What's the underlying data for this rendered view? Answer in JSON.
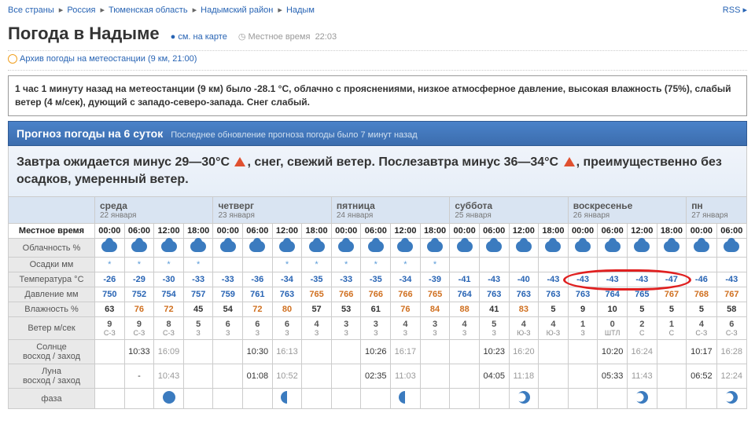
{
  "breadcrumb": [
    "Все страны",
    "Россия",
    "Тюменская область",
    "Надымский район",
    "Надым"
  ],
  "rss": "RSS",
  "title": "Погода в Надыме",
  "map_link": "см. на карте",
  "local_time_label": "Местное время",
  "local_time": "22:03",
  "archive": "Архив погоды на метеостанции (9 км, 21:00)",
  "now": "1 час 1 минуту назад на метеостанции (9 км) было -28.1 °C, облачно с прояснениями, низкое атмосферное давление, высокая влажность (75%), слабый ветер (4 м/сек), дующий с западо-северо-запада. Снег слабый.",
  "forecast_header": "Прогноз погоды на 6 суток",
  "forecast_upd": "Последнее обновление прогноза погоды было 7 минут назад",
  "summary": {
    "p1": "Завтра ожидается минус 29—30°C",
    "p2": ", снег, свежий ветер. Послезавтра минус 36—34°C",
    "p3": ", преимущественно без осадков, умеренный ветер."
  },
  "row_labels": {
    "time": "Местное время",
    "cloud": "Облачность %",
    "precip": "Осадки мм",
    "temp": "Температура °C",
    "press": "Давление мм",
    "hum": "Влажность %",
    "wind": "Ветер м/сек",
    "sun": "Солнце\nвосход / заход",
    "moon": "Луна\nвосход / заход",
    "phase": "фаза"
  },
  "days": [
    {
      "name": "среда",
      "date": "22 января",
      "hours": [
        "00:00",
        "06:00",
        "12:00",
        "18:00"
      ]
    },
    {
      "name": "четверг",
      "date": "23 января",
      "hours": [
        "00:00",
        "06:00",
        "12:00",
        "18:00"
      ]
    },
    {
      "name": "пятница",
      "date": "24 января",
      "hours": [
        "00:00",
        "06:00",
        "12:00",
        "18:00"
      ]
    },
    {
      "name": "суббота",
      "date": "25 января",
      "hours": [
        "00:00",
        "06:00",
        "12:00",
        "18:00"
      ]
    },
    {
      "name": "воскресенье",
      "date": "26 января",
      "hours": [
        "00:00",
        "06:00",
        "12:00",
        "18:00"
      ]
    },
    {
      "name": "пн",
      "date": "27 января",
      "hours": [
        "00:00",
        "06:00"
      ]
    }
  ],
  "precip": [
    "*",
    "*",
    "*",
    "*",
    "",
    "",
    "*",
    "*",
    "*",
    "*",
    "*",
    "*",
    "",
    "",
    "",
    "",
    "",
    "",
    "",
    "",
    "",
    ""
  ],
  "temp": [
    "-26",
    "-29",
    "-30",
    "-33",
    "-33",
    "-36",
    "-34",
    "-35",
    "-33",
    "-35",
    "-34",
    "-39",
    "-41",
    "-43",
    "-40",
    "-43",
    "-43",
    "-43",
    "-43",
    "-47",
    "-46",
    "-43"
  ],
  "press": [
    {
      "v": "750"
    },
    {
      "v": "752"
    },
    {
      "v": "754"
    },
    {
      "v": "757"
    },
    {
      "v": "759"
    },
    {
      "v": "761"
    },
    {
      "v": "763"
    },
    {
      "v": "765",
      "o": 1
    },
    {
      "v": "766",
      "o": 1
    },
    {
      "v": "766",
      "o": 1
    },
    {
      "v": "766",
      "o": 1
    },
    {
      "v": "765",
      "o": 1
    },
    {
      "v": "764"
    },
    {
      "v": "763"
    },
    {
      "v": "763"
    },
    {
      "v": "763"
    },
    {
      "v": "763"
    },
    {
      "v": "764"
    },
    {
      "v": "765"
    },
    {
      "v": "767",
      "o": 1
    },
    {
      "v": "768",
      "o": 1
    },
    {
      "v": "767",
      "o": 1
    }
  ],
  "hum": [
    {
      "v": "63"
    },
    {
      "v": "76",
      "o": 1
    },
    {
      "v": "72",
      "o": 1
    },
    {
      "v": "45"
    },
    {
      "v": "54"
    },
    {
      "v": "72",
      "o": 1
    },
    {
      "v": "80",
      "o": 1
    },
    {
      "v": "57"
    },
    {
      "v": "53"
    },
    {
      "v": "61"
    },
    {
      "v": "76",
      "o": 1
    },
    {
      "v": "84",
      "o": 1
    },
    {
      "v": "88",
      "o": 1
    },
    {
      "v": "41"
    },
    {
      "v": "83",
      "o": 1
    },
    {
      "v": "5"
    },
    {
      "v": "9"
    },
    {
      "v": "10"
    },
    {
      "v": "5"
    },
    {
      "v": "5"
    },
    {
      "v": "5"
    },
    {
      "v": "58"
    }
  ],
  "wind": [
    {
      "s": "9",
      "d": "С-З"
    },
    {
      "s": "9",
      "d": "С-З"
    },
    {
      "s": "8",
      "d": "С-З"
    },
    {
      "s": "5",
      "d": "З"
    },
    {
      "s": "6",
      "d": "З"
    },
    {
      "s": "6",
      "d": "З"
    },
    {
      "s": "6",
      "d": "З"
    },
    {
      "s": "4",
      "d": "З"
    },
    {
      "s": "3",
      "d": "З"
    },
    {
      "s": "3",
      "d": "З"
    },
    {
      "s": "4",
      "d": "З"
    },
    {
      "s": "3",
      "d": "З"
    },
    {
      "s": "4",
      "d": "З"
    },
    {
      "s": "5",
      "d": "З"
    },
    {
      "s": "4",
      "d": "Ю-З"
    },
    {
      "s": "4",
      "d": "Ю-З"
    },
    {
      "s": "1",
      "d": "З"
    },
    {
      "s": "0",
      "d": "ШТЛ"
    },
    {
      "s": "2",
      "d": "С"
    },
    {
      "s": "1",
      "d": "С"
    },
    {
      "s": "4",
      "d": "С-З"
    },
    {
      "s": "6",
      "d": "С-З"
    }
  ],
  "sun": [
    [
      "10:33",
      "16:09"
    ],
    [
      "10:30",
      "16:13"
    ],
    [
      "10:26",
      "16:17"
    ],
    [
      "10:23",
      "16:20"
    ],
    [
      "10:20",
      "16:24"
    ],
    [
      "10:17",
      "16:28"
    ]
  ],
  "moon": [
    [
      "-",
      "10:43"
    ],
    [
      "01:08",
      "10:52"
    ],
    [
      "02:35",
      "11:03"
    ],
    [
      "04:05",
      "11:18"
    ],
    [
      "05:33",
      "11:43"
    ],
    [
      "06:52",
      "12:24"
    ]
  ],
  "highlight_cols": [
    16,
    17,
    18,
    19
  ]
}
